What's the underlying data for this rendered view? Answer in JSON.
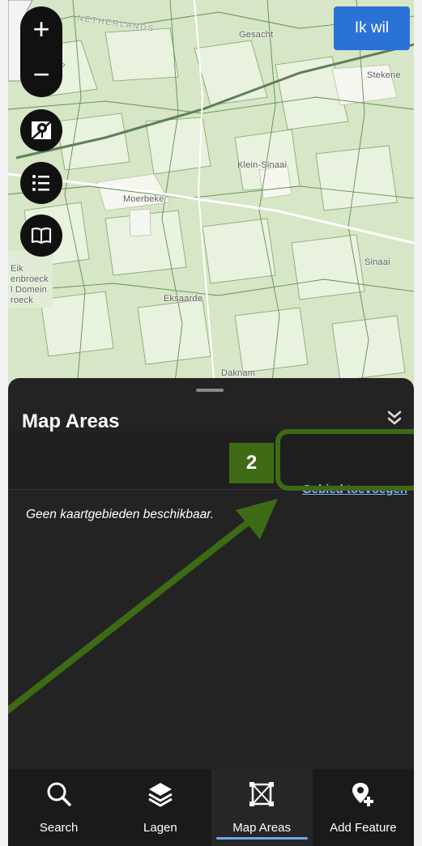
{
  "map": {
    "places": [
      "NETHERLANDS",
      "Gesacht",
      "Stekene",
      "Klein-Sinaai",
      "Moerbeke",
      "Sinaai",
      "Eksaarde",
      "Daknam",
      "Eik",
      "enbroeck",
      "l Domein",
      "roeck"
    ]
  },
  "controls": {
    "zoom_in": "+",
    "zoom_out": "−",
    "ik_wil": "Ik wil"
  },
  "sheet": {
    "title": "Map Areas",
    "add_area_link": "Gebied toevoegen",
    "empty_message": "Geen kaartgebieden beschikbaar."
  },
  "annotation": {
    "step_number": "2",
    "color": "#3d6b15"
  },
  "bottom_nav": {
    "items": [
      {
        "label": "Search",
        "icon": "search-icon"
      },
      {
        "label": "Lagen",
        "icon": "layers-icon"
      },
      {
        "label": "Map Areas",
        "icon": "map-areas-icon",
        "active": true
      },
      {
        "label": "Add Feature",
        "icon": "add-feature-icon"
      }
    ]
  }
}
